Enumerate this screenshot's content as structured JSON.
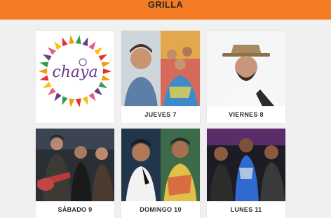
{
  "header": {
    "title": "GRILLA"
  },
  "logo": {
    "text": "chaya"
  },
  "cards": [
    {
      "label": "JUEVES 7"
    },
    {
      "label": "VIERNES 8"
    },
    {
      "label": "SÁBADO 9"
    },
    {
      "label": "DOMINGO 10"
    },
    {
      "label": "LUNES 11"
    }
  ],
  "colors": {
    "header_bg": "#f47a24",
    "page_bg": "#f0f0f0",
    "card_bg": "#ffffff",
    "label_text": "#2a2a2a"
  }
}
